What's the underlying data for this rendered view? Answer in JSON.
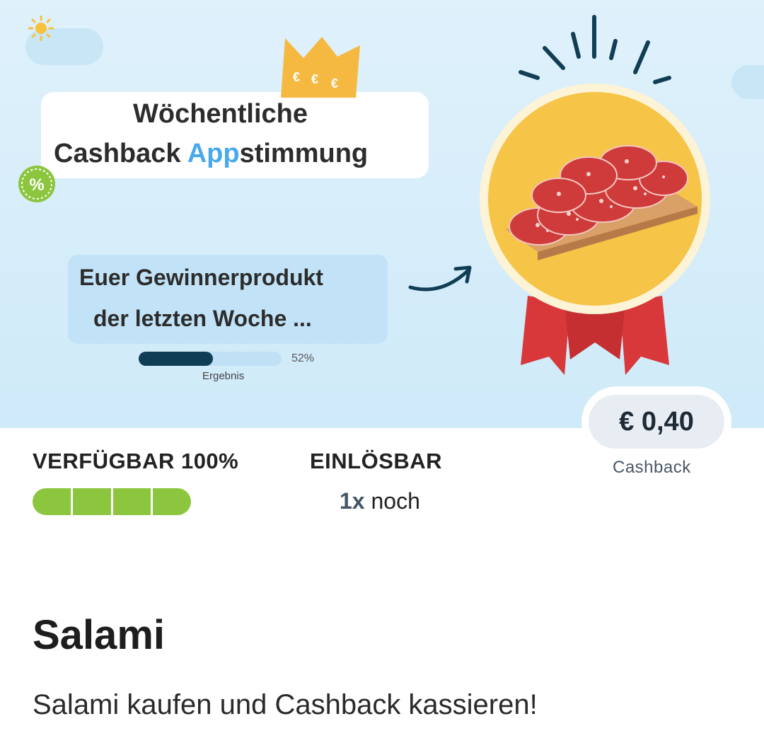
{
  "banner": {
    "title_line1": "Wöchentliche",
    "title_line2_prefix": "Cashback ",
    "title_line2_highlight": "App",
    "title_line2_suffix": "stimmung",
    "subtitle_line1": "Euer Gewinnerprodukt",
    "subtitle_line2": "der letzten Woche ...",
    "crown_symbols": [
      "€",
      "€",
      "€"
    ],
    "percent_badge": "%",
    "result": {
      "percent": 52,
      "percent_text": "52%",
      "label": "Ergebnis"
    },
    "colors": {
      "sky": "#dff1fb",
      "medal": "#f6c447",
      "ribbon": "#d9383a",
      "highlight": "#49a9ea",
      "crown": "#f5b942",
      "badge": "#8cc63f"
    }
  },
  "price": {
    "value": "€ 0,40",
    "label": "Cashback"
  },
  "availability": {
    "label": "VERFÜGBAR 100%",
    "segments_total": 4,
    "segments_filled": 4,
    "color": "#8cc63f"
  },
  "redeem": {
    "label": "EINLÖSBAR",
    "count": "1x",
    "suffix": " noch"
  },
  "product": {
    "title": "Salami",
    "description": "Salami kaufen und Cashback kassieren!"
  }
}
